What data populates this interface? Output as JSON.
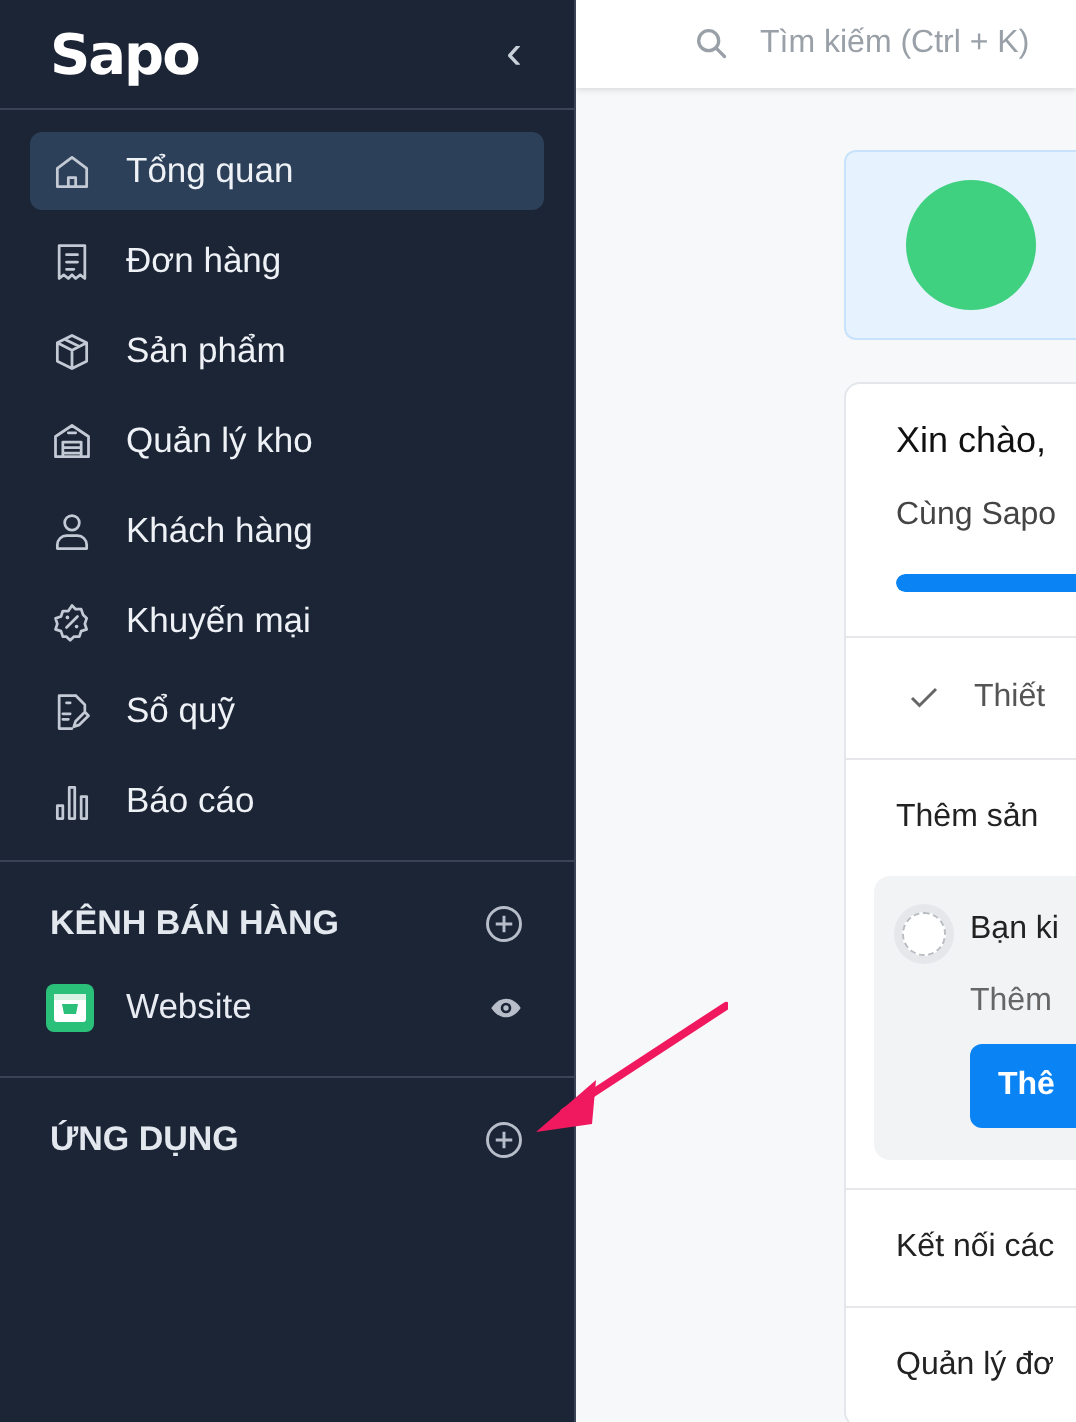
{
  "sidebar": {
    "logo": "Sapo",
    "collapse": "‹",
    "items": [
      {
        "label": "Tổng quan",
        "selected": true
      },
      {
        "label": "Đơn hàng",
        "selected": false
      },
      {
        "label": "Sản phẩm",
        "selected": false
      },
      {
        "label": "Quản lý kho",
        "selected": false
      },
      {
        "label": "Khách hàng",
        "selected": false
      },
      {
        "label": "Khuyến mại",
        "selected": false
      },
      {
        "label": "Sổ quỹ",
        "selected": false
      },
      {
        "label": "Báo cáo",
        "selected": false
      }
    ],
    "sections": [
      {
        "title": "KÊNH BÁN HÀNG",
        "items": [
          {
            "label": "Website"
          }
        ]
      },
      {
        "title": "ỨNG DỤNG"
      }
    ]
  },
  "search": {
    "placeholder": "Tìm kiếm (Ctrl + K)"
  },
  "welcome": {
    "title": "Xin chào,",
    "subtitle": "Cùng Sapo",
    "progress": {
      "level": 1
    },
    "steps": [
      {
        "label": "Thiết",
        "done": true
      }
    ],
    "task_group": {
      "title": "Thêm sản",
      "task": {
        "title": "Bạn ki",
        "description": "Thêm",
        "button": "Thê",
        "checked": false
      }
    },
    "more_groups": [
      "Kết nối các",
      "Quản lý đơ"
    ]
  }
}
